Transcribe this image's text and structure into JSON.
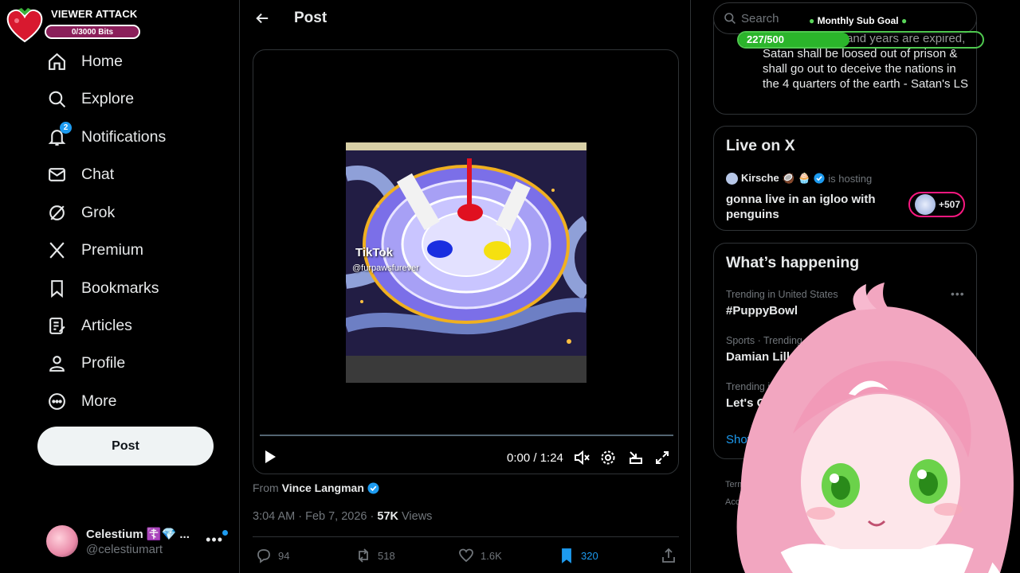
{
  "overlay": {
    "viewer_attack_title": "VIEWER ATTACK",
    "bits_progress": "0/3000 Bits",
    "sub_goal_title": "Monthly Sub Goal",
    "sub_goal_count": "227/500",
    "sub_goal_fraction": 0.454
  },
  "nav": {
    "items": [
      {
        "label": "Home",
        "icon": "home-icon"
      },
      {
        "label": "Explore",
        "icon": "search-icon"
      },
      {
        "label": "Notifications",
        "icon": "bell-icon",
        "badge": "2"
      },
      {
        "label": "Chat",
        "icon": "mail-icon"
      },
      {
        "label": "Grok",
        "icon": "grok-icon"
      },
      {
        "label": "Premium",
        "icon": "x-logo-icon"
      },
      {
        "label": "Bookmarks",
        "icon": "bookmark-icon"
      },
      {
        "label": "Articles",
        "icon": "article-icon"
      },
      {
        "label": "Profile",
        "icon": "person-icon"
      },
      {
        "label": "More",
        "icon": "more-circle-icon"
      }
    ],
    "post_button": "Post"
  },
  "account": {
    "name": "Celestium ☦️💎 ...",
    "handle": "@celestiumart",
    "more": "•••"
  },
  "post": {
    "header_title": "Post",
    "video": {
      "watermark_brand": "TikTok",
      "watermark_handle": "@furpawsfurever",
      "time": "0:00 / 1:24",
      "progress_fraction": 0
    },
    "from_prefix": "From",
    "from_name": "Vince Langman",
    "timestamp": "3:04 AM · Feb 7, 2026 · ",
    "views_count": "57K",
    "views_label": " Views",
    "actions": {
      "replies": "94",
      "reposts": "518",
      "likes": "1.6K",
      "bookmarks": "320"
    }
  },
  "sidebar": {
    "search_placeholder": "Search",
    "quote_text": "When the thousand years are expired, Satan shall be loosed out of prison & shall go out to deceive the nations in the 4 quarters of the earth - Satan's LS",
    "live": {
      "title": "Live on X",
      "host_name": "Kirsche 🥥 🧁",
      "host_suffix": "is hosting",
      "stream_title": "gonna live in an igloo with penguins",
      "listeners": "+507"
    },
    "whats_happening": {
      "title": "What’s happening",
      "trends": [
        {
          "meta": "Trending in United States",
          "name": "#PuppyBowl"
        },
        {
          "meta": "Sports · Trending",
          "name": "Damian Lilla"
        },
        {
          "meta": "Trending in",
          "name": "Let's Go"
        }
      ],
      "show_more": "Show m"
    },
    "footer": [
      "Terms of",
      "Accessibilit"
    ]
  },
  "colors": {
    "accent": "#1d9bf0",
    "background": "#000000",
    "text_primary": "#e7e9ea",
    "text_secondary": "#71767b",
    "live_ring": "#f91880",
    "goal_green": "#2bb52b"
  }
}
